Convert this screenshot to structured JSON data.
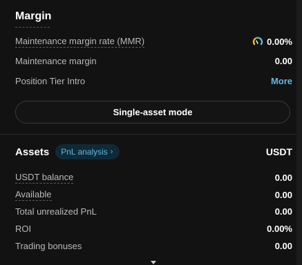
{
  "margin": {
    "title": "Margin",
    "rows": [
      {
        "label": "Maintenance margin rate (MMR)",
        "value": "0.00%"
      },
      {
        "label": "Maintenance margin",
        "value": "0.00"
      },
      {
        "label": "Position Tier Intro",
        "value": "More"
      }
    ],
    "mode_button_label": "Single-asset mode",
    "gauge_icon": "mmr-gauge-icon",
    "gauge_colors": [
      "#f5b642",
      "#4cc38a",
      "#5fb9e6"
    ]
  },
  "assets": {
    "title": "Assets",
    "pnl_chip_label": "PnL analysis",
    "pnl_chip_chevron": "›",
    "currency": "USDT",
    "rows": [
      {
        "label": "USDT balance",
        "value": "0.00"
      },
      {
        "label": "Available",
        "value": "0.00"
      },
      {
        "label": "Total unrealized PnL",
        "value": "0.00"
      },
      {
        "label": "ROI",
        "value": "0.00%"
      },
      {
        "label": "Trading bonuses",
        "value": "0.00"
      }
    ]
  },
  "colors": {
    "background": "#121212",
    "link": "#5fb9e6",
    "text_primary": "#ffffff",
    "text_secondary": "#b9b9b9"
  }
}
